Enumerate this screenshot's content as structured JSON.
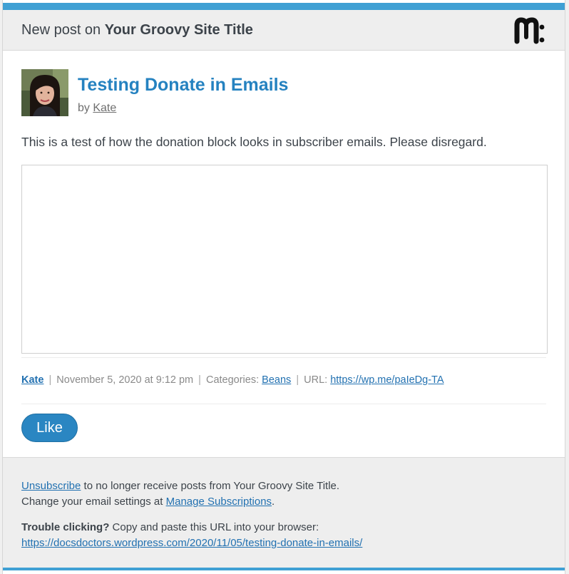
{
  "header": {
    "prefix": "New post on",
    "site_title": "Your Groovy Site Title",
    "logo_icon": "mailpoet-m-logo"
  },
  "post": {
    "title": "Testing Donate in Emails",
    "by_label": "by",
    "author": "Kate",
    "body": "This is a test of how the donation block looks in subscriber emails. Please disregard."
  },
  "meta": {
    "author": "Kate",
    "date": "November 5, 2020 at 9:12 pm",
    "categories_label": "Categories:",
    "category": "Beans",
    "url_label": "URL:",
    "short_url": "https://wp.me/paIeDg-TA",
    "separator": "|"
  },
  "like": {
    "label": "Like"
  },
  "footer": {
    "unsubscribe_link": "Unsubscribe",
    "unsubscribe_text": "to no longer receive posts from Your Groovy Site Title.",
    "settings_text": "Change your email settings at",
    "manage_link": "Manage Subscriptions",
    "period": ".",
    "trouble_label": "Trouble clicking?",
    "trouble_text": "Copy and paste this URL into your browser:",
    "post_url": "https://docsdoctors.wordpress.com/2020/11/05/testing-donate-in-emails/"
  },
  "colors": {
    "accent": "#3fa0d4",
    "link": "#2271b1",
    "title": "#2582c0",
    "button": "#2a86c2",
    "header_bg": "#eeeeee"
  }
}
